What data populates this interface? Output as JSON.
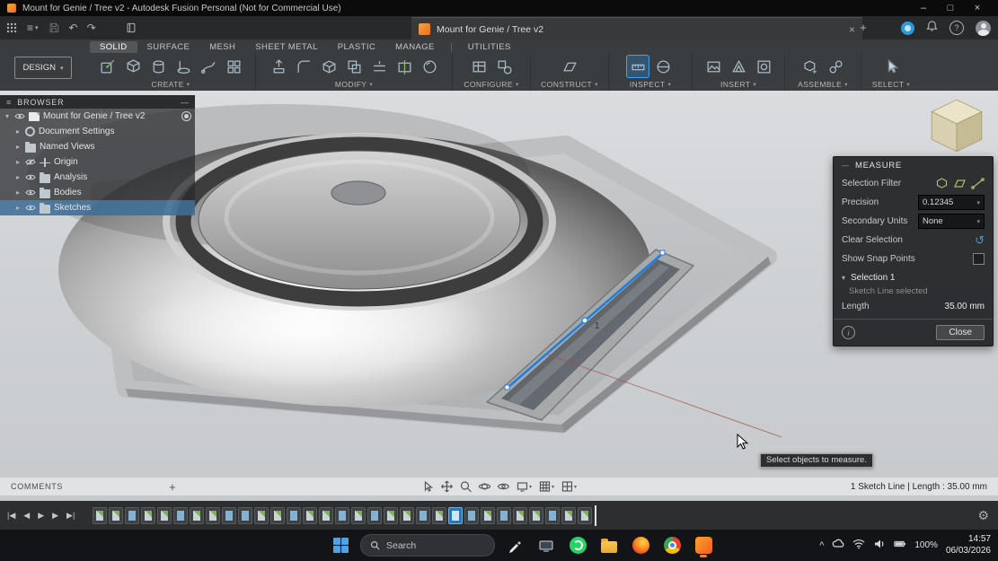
{
  "window": {
    "title": "Mount for Genie / Tree v2 - Autodesk Fusion Personal (Not for Commercial Use)",
    "minimize": "–",
    "maximize": "□",
    "close": "×"
  },
  "ui": {
    "caret": "▾",
    "tree_expand": "▸",
    "tree_collapse": "▾",
    "panel_collapse": "—",
    "menu": "≡",
    "undo_arrow": "↶",
    "redo_arrow": "↷",
    "undo_curved": "↺",
    "gear": "⚙",
    "plus": "+",
    "close_x": "×",
    "question": "?",
    "chevron_up": "^",
    "tl_first": "|◀",
    "tl_prev": "◀",
    "tl_play": "▶",
    "tl_next": "▶",
    "tl_last": "▶|"
  },
  "app_bar": {
    "tab_title": "Mount for Genie / Tree v2"
  },
  "ribbon": {
    "design_button": "DESIGN",
    "tabs": [
      "SOLID",
      "SURFACE",
      "MESH",
      "SHEET METAL",
      "PLASTIC",
      "MANAGE",
      "UTILITIES"
    ],
    "groups": [
      {
        "label": "CREATE"
      },
      {
        "label": "MODIFY"
      },
      {
        "label": "CONFIGURE"
      },
      {
        "label": "CONSTRUCT"
      },
      {
        "label": "INSPECT"
      },
      {
        "label": "INSERT"
      },
      {
        "label": "ASSEMBLE"
      },
      {
        "label": "SELECT"
      }
    ]
  },
  "browser": {
    "title": "BROWSER",
    "root_label": "Mount for Genie / Tree v2",
    "items": [
      {
        "label": "Document Settings"
      },
      {
        "label": "Named Views"
      },
      {
        "label": "Origin"
      },
      {
        "label": "Analysis"
      },
      {
        "label": "Bodies"
      },
      {
        "label": "Sketches"
      }
    ]
  },
  "viewport": {
    "dimension_label": "1",
    "tooltip": "Select objects to measure."
  },
  "measure": {
    "title": "MEASURE",
    "selection_filter_label": "Selection Filter",
    "precision_label": "Precision",
    "precision_value": "0.12345",
    "secondary_units_label": "Secondary Units",
    "secondary_units_value": "None",
    "clear_selection_label": "Clear Selection",
    "show_snap_points_label": "Show Snap Points",
    "selection_header": "Selection 1",
    "selection_status": "Sketch Line selected",
    "length_label": "Length",
    "length_value": "35.00 mm",
    "close_button": "Close"
  },
  "status_bar": {
    "comments_label": "COMMENTS",
    "selection_summary": "1 Sketch Line | Length : 35.00 mm"
  },
  "timeline": {
    "pattern": "ssfssfssffssfssfsfssfsSfsfssfss",
    "legend": {
      "s": "sketch-feature",
      "f": "solid-feature",
      "S": "selected-feature"
    }
  },
  "taskbar": {
    "search_placeholder": "Search",
    "battery_percent": "100%",
    "time": "14:57",
    "date": "06/03/2026"
  }
}
